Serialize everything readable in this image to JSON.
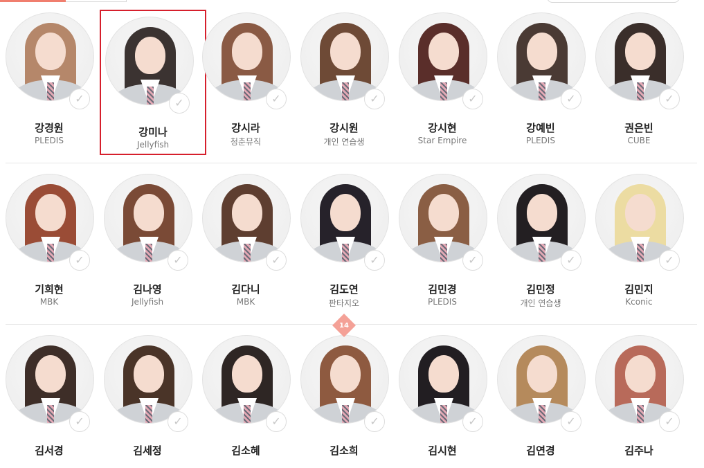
{
  "colors": {
    "accent": "#f07e6e",
    "selection_border": "#d61f2c",
    "badge": "#f4a197"
  },
  "icons": {
    "check": "✓"
  },
  "page_badge": "14",
  "rows": [
    {
      "trainees": [
        {
          "name": "강경원",
          "agency": "PLEDIS",
          "hair": "#b5876a"
        },
        {
          "name": "강미나",
          "agency": "Jellyfish",
          "hair": "#3b3331",
          "selected": true
        },
        {
          "name": "강시라",
          "agency": "청춘뮤직",
          "hair": "#8a5a44"
        },
        {
          "name": "강시원",
          "agency": "개인 연습생",
          "hair": "#6e4a36"
        },
        {
          "name": "강시현",
          "agency": "Star Empire",
          "hair": "#5a2e2a"
        },
        {
          "name": "강예빈",
          "agency": "PLEDIS",
          "hair": "#4a3a34"
        },
        {
          "name": "권은빈",
          "agency": "CUBE",
          "hair": "#3a2e2a"
        }
      ]
    },
    {
      "trainees": [
        {
          "name": "기희현",
          "agency": "MBK",
          "hair": "#9a4c36"
        },
        {
          "name": "김나영",
          "agency": "Jellyfish",
          "hair": "#7a4a36"
        },
        {
          "name": "김다니",
          "agency": "MBK",
          "hair": "#5e3e30"
        },
        {
          "name": "김도연",
          "agency": "판타지오",
          "hair": "#26222a"
        },
        {
          "name": "김민경",
          "agency": "PLEDIS",
          "hair": "#8a5e44"
        },
        {
          "name": "김민정",
          "agency": "개인 연습생",
          "hair": "#231f22"
        },
        {
          "name": "김민지",
          "agency": "Kconic",
          "hair": "#ecdca2"
        }
      ]
    },
    {
      "trainees": [
        {
          "name": "김서경",
          "agency": "",
          "hair": "#3e2e28"
        },
        {
          "name": "김세정",
          "agency": "",
          "hair": "#4a3428"
        },
        {
          "name": "김소혜",
          "agency": "",
          "hair": "#2e2624"
        },
        {
          "name": "김소희",
          "agency": "",
          "hair": "#8e5a40"
        },
        {
          "name": "김시현",
          "agency": "",
          "hair": "#221e22"
        },
        {
          "name": "김연경",
          "agency": "",
          "hair": "#b58a5c"
        },
        {
          "name": "김주나",
          "agency": "",
          "hair": "#b86a5a"
        }
      ]
    }
  ]
}
